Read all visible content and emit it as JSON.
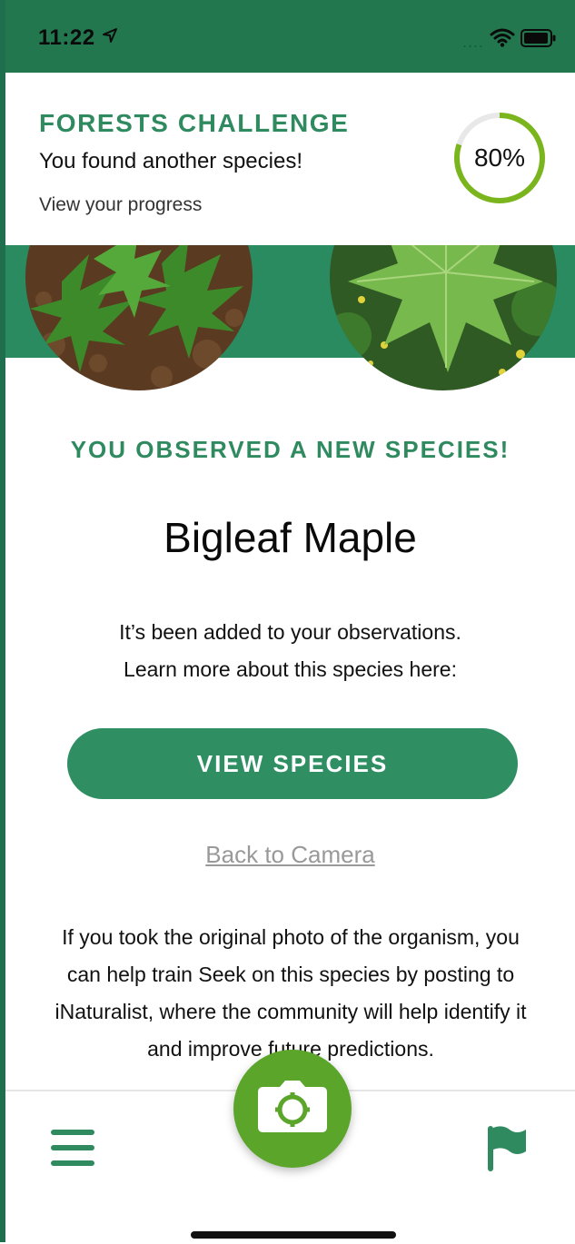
{
  "status_bar": {
    "time": "11:22",
    "signal": "....",
    "icons": [
      "location-arrow-icon",
      "wifi-icon",
      "battery-icon"
    ]
  },
  "banner": {
    "title": "FORESTS CHALLENGE",
    "subtitle": "You found another species!",
    "link": "View your progress",
    "progress_percent": 80,
    "progress_label": "80%"
  },
  "photos": {
    "left": "species-photo-user",
    "right": "species-photo-reference"
  },
  "result": {
    "heading": "YOU OBSERVED A NEW SPECIES!",
    "species_name": "Bigleaf Maple",
    "added_line1": "It’s been added to your observations.",
    "added_line2": "Learn more about this species here:",
    "view_button": "VIEW SPECIES",
    "back_link": "Back to Camera",
    "train_text": "If you took the original photo of the organism, you can help train Seek on this species by posting to iNaturalist, where the community will help identify it and improve future predictions."
  },
  "nav": {
    "menu": "menu-icon",
    "camera": "camera-icon",
    "challenges": "flag-icon"
  },
  "colors": {
    "brand_green": "#2f8a5f",
    "status_green": "#23774f",
    "camera_green": "#5aa52a",
    "progress_green": "#7ab51d"
  }
}
